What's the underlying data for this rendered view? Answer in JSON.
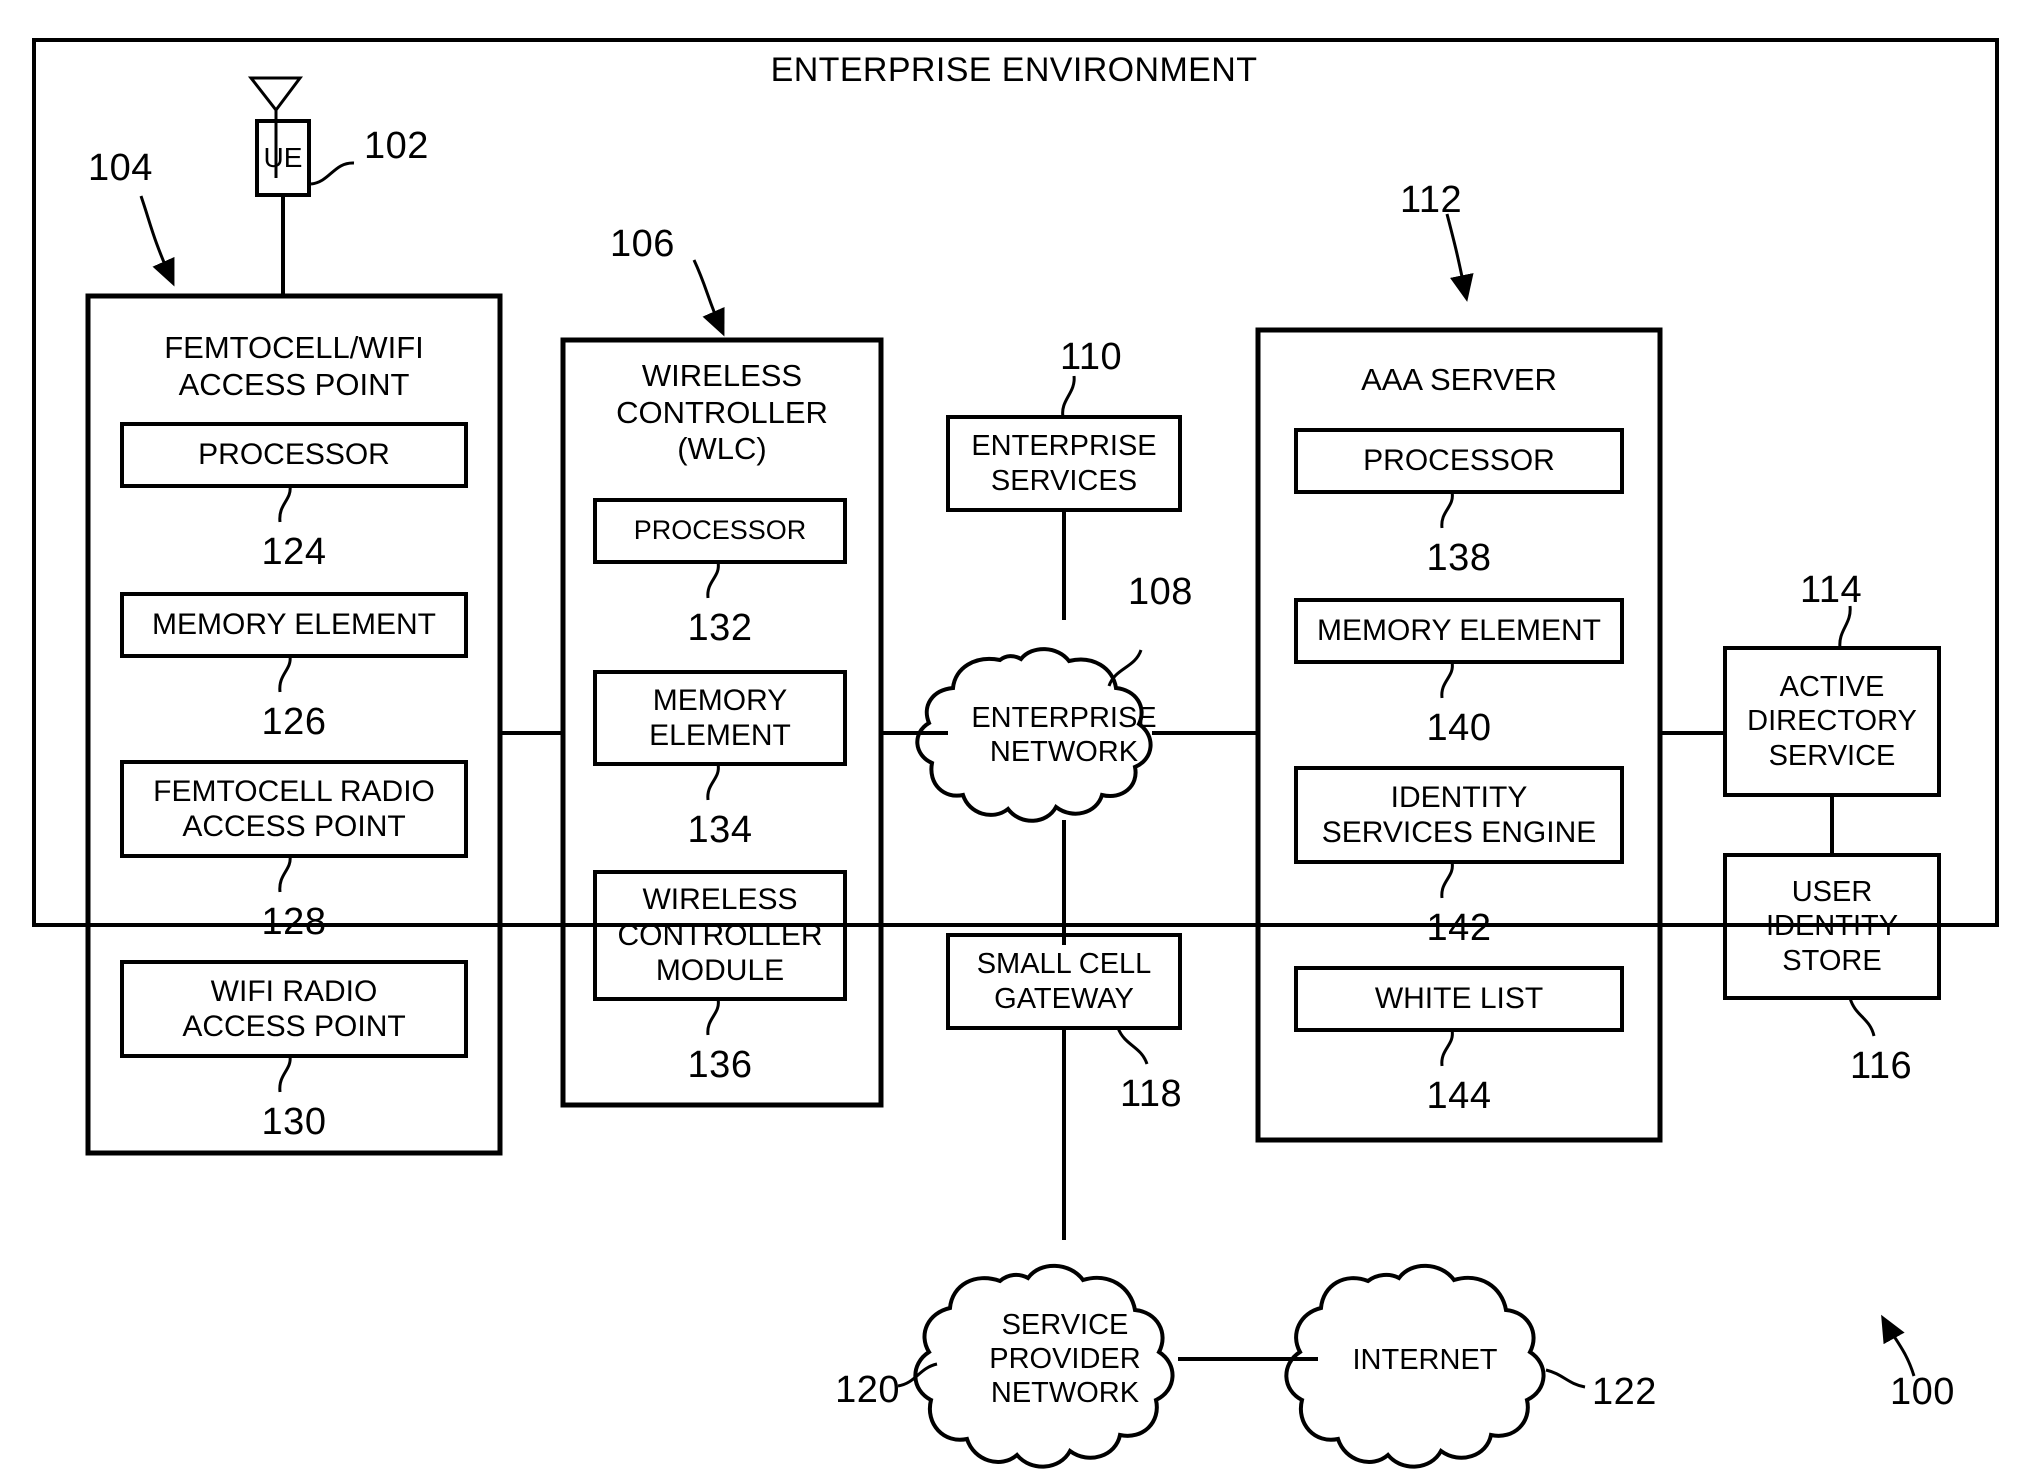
{
  "figure": {
    "title": "ENTERPRISE ENVIRONMENT",
    "figure_ref": "100"
  },
  "ue": {
    "label": "UE",
    "ref": "102"
  },
  "femtocell_ap": {
    "title": "FEMTOCELL/WIFI\nACCESS POINT",
    "ref": "104",
    "components": [
      {
        "label": "PROCESSOR",
        "ref": "124"
      },
      {
        "label": "MEMORY ELEMENT",
        "ref": "126"
      },
      {
        "label": "FEMTOCELL RADIO\nACCESS POINT",
        "ref": "128"
      },
      {
        "label": "WIFI RADIO\nACCESS POINT",
        "ref": "130"
      }
    ]
  },
  "wlc": {
    "title": "WIRELESS\nCONTROLLER\n(WLC)",
    "ref": "106",
    "components": [
      {
        "label": "PROCESSOR",
        "ref": "132"
      },
      {
        "label": "MEMORY\nELEMENT",
        "ref": "134"
      },
      {
        "label": "WIRELESS\nCONTROLLER\nMODULE",
        "ref": "136"
      }
    ]
  },
  "enterprise_services": {
    "label": "ENTERPRISE\nSERVICES",
    "ref": "110"
  },
  "enterprise_network": {
    "label": "ENTERPRISE\nNETWORK",
    "ref": "108"
  },
  "small_cell_gateway": {
    "label": "SMALL CELL\nGATEWAY",
    "ref": "118"
  },
  "aaa_server": {
    "title": "AAA SERVER",
    "ref": "112",
    "components": [
      {
        "label": "PROCESSOR",
        "ref": "138"
      },
      {
        "label": "MEMORY ELEMENT",
        "ref": "140"
      },
      {
        "label": "IDENTITY\nSERVICES ENGINE",
        "ref": "142"
      },
      {
        "label": "WHITE LIST",
        "ref": "144"
      }
    ]
  },
  "active_directory_service": {
    "label": "ACTIVE\nDIRECTORY\nSERVICE",
    "ref": "114"
  },
  "user_identity_store": {
    "label": "USER\nIDENTITY\nSTORE",
    "ref": "116"
  },
  "service_provider_network": {
    "label": "SERVICE\nPROVIDER\nNETWORK",
    "ref": "120"
  },
  "internet": {
    "label": "INTERNET",
    "ref": "122"
  },
  "colors": {
    "stroke": "#000000",
    "background": "#ffffff"
  }
}
